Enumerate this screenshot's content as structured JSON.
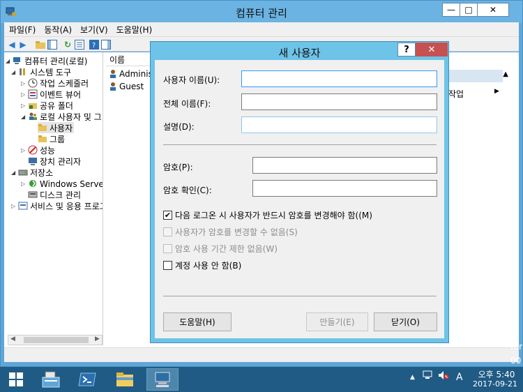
{
  "window": {
    "title": "컴퓨터 관리",
    "minimize_glyph": "—",
    "maximize_glyph": "□",
    "close_glyph": "✕"
  },
  "menu": [
    "파일(F)",
    "동작(A)",
    "보기(V)",
    "도움말(H)"
  ],
  "tree": {
    "items": [
      {
        "label": "컴퓨터 관리(로컬)",
        "icon": "computer-management-icon"
      },
      {
        "label": "시스템 도구",
        "icon": "tools-icon"
      },
      {
        "label": "작업 스케줄러",
        "icon": "clock-icon"
      },
      {
        "label": "이벤트 뷰어",
        "icon": "event-viewer-icon"
      },
      {
        "label": "공유 폴더",
        "icon": "shared-folder-icon"
      },
      {
        "label": "로컬 사용자 및 그",
        "icon": "users-icon"
      },
      {
        "label": "사용자",
        "icon": "folder-icon"
      },
      {
        "label": "그룹",
        "icon": "folder-icon"
      },
      {
        "label": "성능",
        "icon": "performance-icon"
      },
      {
        "label": "장치 관리자",
        "icon": "device-manager-icon"
      },
      {
        "label": "저장소",
        "icon": "storage-icon"
      },
      {
        "label": "Windows Server 백",
        "icon": "backup-icon"
      },
      {
        "label": "디스크 관리",
        "icon": "disk-icon"
      },
      {
        "label": "서비스 및 응용 프로그",
        "icon": "services-icon"
      }
    ]
  },
  "list": {
    "column": "이름",
    "rows": [
      "Administr",
      "Guest"
    ]
  },
  "actions": {
    "more": "작업"
  },
  "dialog": {
    "title": "새 사용자",
    "help_glyph": "?",
    "close_glyph": "✕",
    "username_label": "사용자 이름(U):",
    "username_value": "",
    "fullname_label": "전체 이름(F):",
    "fullname_value": "",
    "description_label": "설명(D):",
    "description_value": "",
    "password_label": "암호(P):",
    "confirm_label": "암호 확인(C):",
    "must_change": {
      "label": "다음 로그온 시 사용자가 반드시 암호를 변경해야 함((M)",
      "checked": true
    },
    "cannot_change": {
      "label": "사용자가 암호를 변경할 수 없음(S)",
      "checked": false
    },
    "never_expires": {
      "label": "암호 사용 기간 제한 없음(W)",
      "checked": false
    },
    "disabled": {
      "label": "계정 사용 안 함(B)",
      "checked": false
    },
    "help_button": "도움말(H)",
    "create_button": "만들기(E)",
    "close_button": "닫기(O)"
  },
  "taskbar": {
    "time": "오후 5:40",
    "date": "2017-09-21",
    "ime": "A",
    "edge_text_1": "ter",
    "edge_text_2": "00"
  },
  "colors": {
    "titlebar": "#6ab3e2",
    "dialog_frame": "#6dc3e8",
    "close_red": "#c75050",
    "taskbar": "#1f5b85"
  }
}
